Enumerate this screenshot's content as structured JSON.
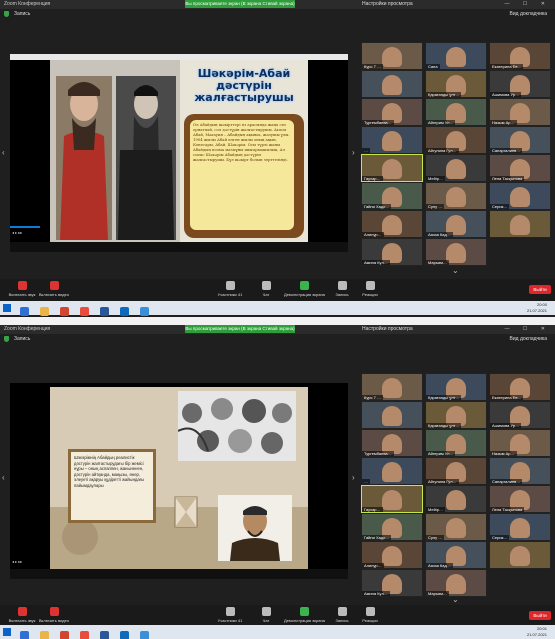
{
  "shot1": {
    "titlebar": {
      "app": "Zoom Конференция",
      "share": "Вы просматриваете экран (В экрана Стивай экрана)",
      "view": "Настройки просмотра",
      "controls": "— ☐ ✕"
    },
    "subbar": {
      "rec": "Запись",
      "speaker": "Вид докладчика"
    },
    "slide": {
      "title_line1": "Шәкәрім-Абай",
      "title_line2": "дәстүрін",
      "title_line3": "жалғастырушы",
      "body": "Ол Абайдың шәкірттері өз арасында жаңа сөз орнатпай, сол дәстүрін жалғастырушы. Ағасы Абай, Мағауия – Абайдың ақынға, жазушы ұлы. 1904 жылы Абай өлген жылы оның ақын, Кенесары, Абай, Шәкәрім. Осы түрлі жаны Абайдың поэма мазмұны шығармашылық. Ал соғыс Шәкәрім Абайдың дәстүрін жалғастырушы. Бұл шәкірт болып зерттелінді."
    },
    "tiles": [
      {
        "label": "Курс 7 …"
      },
      {
        "label": "Сапа"
      },
      {
        "label": "Екатерина Ев…"
      },
      {
        "label": ""
      },
      {
        "label": "Қарағанды ұлт…"
      },
      {
        "label": "Ашимова Ур…"
      },
      {
        "label": "Тургембаева…"
      },
      {
        "label": "Айгерим Ул…"
      },
      {
        "label": "Назым Ар…"
      },
      {
        "label": "…"
      },
      {
        "label": "Айгулина Гул…"
      },
      {
        "label": "Сапаргалиев…"
      },
      {
        "label": "Гаухар…"
      },
      {
        "label": "Мейір…"
      },
      {
        "label": "Лена Тасқынова"
      },
      {
        "label": "Гайни Хадо…"
      },
      {
        "label": "Сулу …"
      },
      {
        "label": "Серик…"
      },
      {
        "label": "Алинур…"
      },
      {
        "label": "Азиза Кад…"
      },
      {
        "label": ""
      },
      {
        "label": "Амина Кул…"
      },
      {
        "label": "Марьям…"
      }
    ]
  },
  "shot2": {
    "titlebar": {
      "app": "Zoom Конференция",
      "share": "Вы просматриваете экран (В экрана Стивай экрана)",
      "view": "Настройки просмотра",
      "controls": "— ☐ ✕"
    },
    "subbar": {
      "rec": "Запись",
      "speaker": "Вид докладчика"
    },
    "slide": {
      "body": "Шәкәрімнің Абайдың реалистік дәстүрін жалғастырудағы бір жемісі нұры – оның аспаппен, жаныненен, дәстүрін айтқанда, маңызы, өнер, әлеуеті ақаруы құдіретті жайындағы пайымдаулары"
    },
    "tiles": [
      {
        "label": "Курс 7 …"
      },
      {
        "label": "Қарағанды ұлт…"
      },
      {
        "label": "Екатерина Ев…"
      },
      {
        "label": ""
      },
      {
        "label": "Қарағанды ұлт…"
      },
      {
        "label": "Ашимова Ур…"
      },
      {
        "label": "Тургембаева…"
      },
      {
        "label": "Айгерим Ул…"
      },
      {
        "label": "Назым Ар…"
      },
      {
        "label": "…"
      },
      {
        "label": "Айгулина Гул…"
      },
      {
        "label": "Сапаргалиев…"
      },
      {
        "label": "Гаухар…"
      },
      {
        "label": "Мейір…"
      },
      {
        "label": "Лена Тасқынова"
      },
      {
        "label": "Гайни Хадо…"
      },
      {
        "label": "Сулу …"
      },
      {
        "label": "Серик…"
      },
      {
        "label": "Алинур…"
      },
      {
        "label": "Азиза Кад…"
      },
      {
        "label": ""
      },
      {
        "label": "Амина Кул…"
      },
      {
        "label": "Марьям…"
      }
    ]
  },
  "toolbar": {
    "mute": "Включить звук",
    "video": "Включить видео",
    "participants": "Участники",
    "participants_count": "41",
    "chat": "Чат",
    "share": "Демонстрация экрана",
    "record": "Запись",
    "reactions": "Реакции",
    "end": "Выйти"
  },
  "tray": {
    "time1": "20:00",
    "date1": "21.07.2021",
    "time2": "20:01",
    "date2": "21.07.2021"
  },
  "colors": {
    "share_green": "#2e9e3a",
    "end_red": "#e0252b",
    "accent_blue": "#0a7bd6"
  }
}
